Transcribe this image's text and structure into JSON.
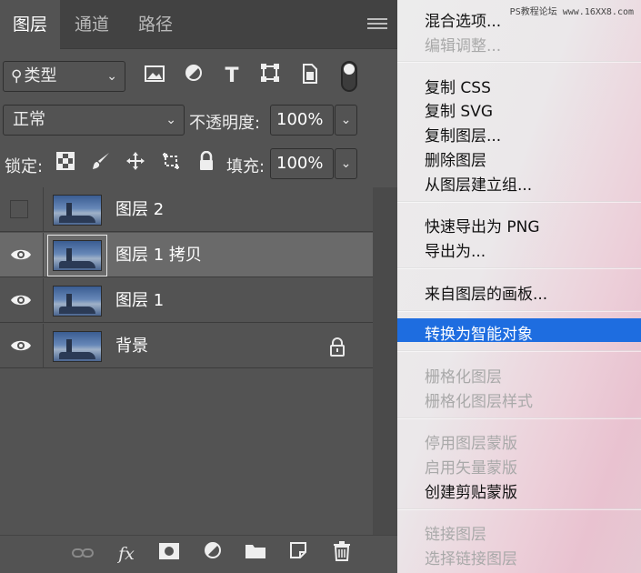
{
  "panel": {
    "tabs": [
      {
        "label": "图层"
      },
      {
        "label": "通道"
      },
      {
        "label": "路径"
      }
    ],
    "filter": {
      "kind_label": "类型"
    },
    "blend": {
      "mode": "正常",
      "opacity_label": "不透明度:",
      "opacity_value": "100%"
    },
    "lock": {
      "label": "锁定:",
      "fill_label": "填充:",
      "fill_value": "100%"
    },
    "layers": [
      {
        "name": "图层 2",
        "visible": false,
        "selected": false,
        "locked": false
      },
      {
        "name": "图层 1 拷贝",
        "visible": true,
        "selected": true,
        "locked": false
      },
      {
        "name": "图层 1",
        "visible": true,
        "selected": false,
        "locked": false
      },
      {
        "name": "背景",
        "visible": true,
        "selected": false,
        "locked": true
      }
    ],
    "bottom_bar": {
      "fx_label": "fx"
    }
  },
  "menu": {
    "watermark": "PS教程论坛 www.16XX8.com",
    "groups": [
      [
        "混合选项...",
        "编辑调整..."
      ],
      [
        "复制 CSS",
        "复制 SVG",
        "复制图层...",
        "删除图层",
        "从图层建立组..."
      ],
      [
        "快速导出为 PNG",
        "导出为..."
      ],
      [
        "来自图层的画板..."
      ],
      [
        "转换为智能对象"
      ],
      [
        "栅格化图层",
        "栅格化图层样式"
      ],
      [
        "停用图层蒙版",
        "启用矢量蒙版",
        "创建剪贴蒙版"
      ],
      [
        "链接图层",
        "选择链接图层"
      ]
    ],
    "highlighted": "转换为智能对象",
    "disabled": [
      "编辑调整...",
      "栅格化图层",
      "栅格化图层样式",
      "停用图层蒙版",
      "启用矢量蒙版",
      "链接图层",
      "选择链接图层"
    ]
  },
  "colors": {
    "panel_bg": "#535353",
    "selected_row": "#6a6a6a",
    "menu_highlight": "#1e6de0"
  }
}
